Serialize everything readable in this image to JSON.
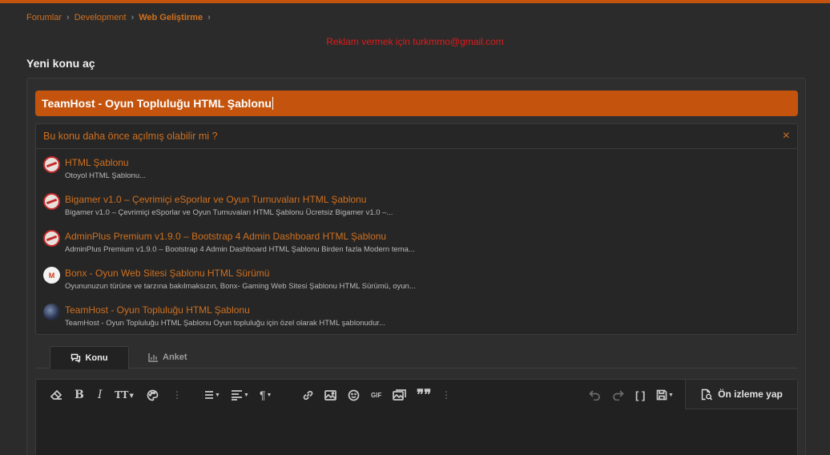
{
  "breadcrumb": {
    "items": [
      "Forumlar",
      "Development",
      "Web Geliştirme"
    ],
    "separator": "›"
  },
  "ad_text": "Reklam vermek için turkmmo@gmail.com",
  "page_title": "Yeni konu aç",
  "title_input": {
    "value": "TeamHost - Oyun Topluluğu HTML Şablonu"
  },
  "similar": {
    "heading": "Bu konu daha önce açılmış olabilir mi ?",
    "close_icon": "×",
    "items": [
      {
        "title": "HTML Şablonu",
        "snippet": "Otoyol HTML Şablonu...",
        "avatar": "stamp"
      },
      {
        "title": "Bigamer v1.0 – Çevrimiçi eSporlar ve Oyun Turnuvaları HTML Şablonu",
        "snippet": "Bigamer v1.0 – Çevrimiçi eSporlar ve Oyun Turnuvaları HTML Şablonu Ücretsiz Bigamer v1.0 –...",
        "avatar": "stamp"
      },
      {
        "title": "AdminPlus Premium v1.9.0 – Bootstrap 4 Admin Dashboard HTML Şablonu",
        "snippet": "AdminPlus Premium v1.9.0 – Bootstrap 4 Admin Dashboard HTML Şablonu Birden fazla Modern tema...",
        "avatar": "stamp"
      },
      {
        "title": "Bonx - Oyun Web Sitesi Şablonu HTML Sürümü",
        "snippet": "Oyununuzun türüne ve tarzına bakılmaksızın, Bonx- Gaming Web Sitesi Şablonu HTML Sürümü, oyun...",
        "avatar": "m"
      },
      {
        "title": "TeamHost - Oyun Topluluğu HTML Şablonu",
        "snippet": "TeamHost - Oyun Topluluğu HTML Şablonu Oyun topluluğu için özel olarak HTML şablonudur...",
        "avatar": "img"
      }
    ]
  },
  "tabs": {
    "thread": "Konu",
    "poll": "Anket"
  },
  "editor": {
    "preview_label": "Ön izleme yap",
    "gif_label": "GIF",
    "more_label": "⋮"
  },
  "colors": {
    "accent": "#c4540d",
    "link": "#d0701f",
    "ad": "#e01b1b",
    "background": "#2b2b2b"
  }
}
